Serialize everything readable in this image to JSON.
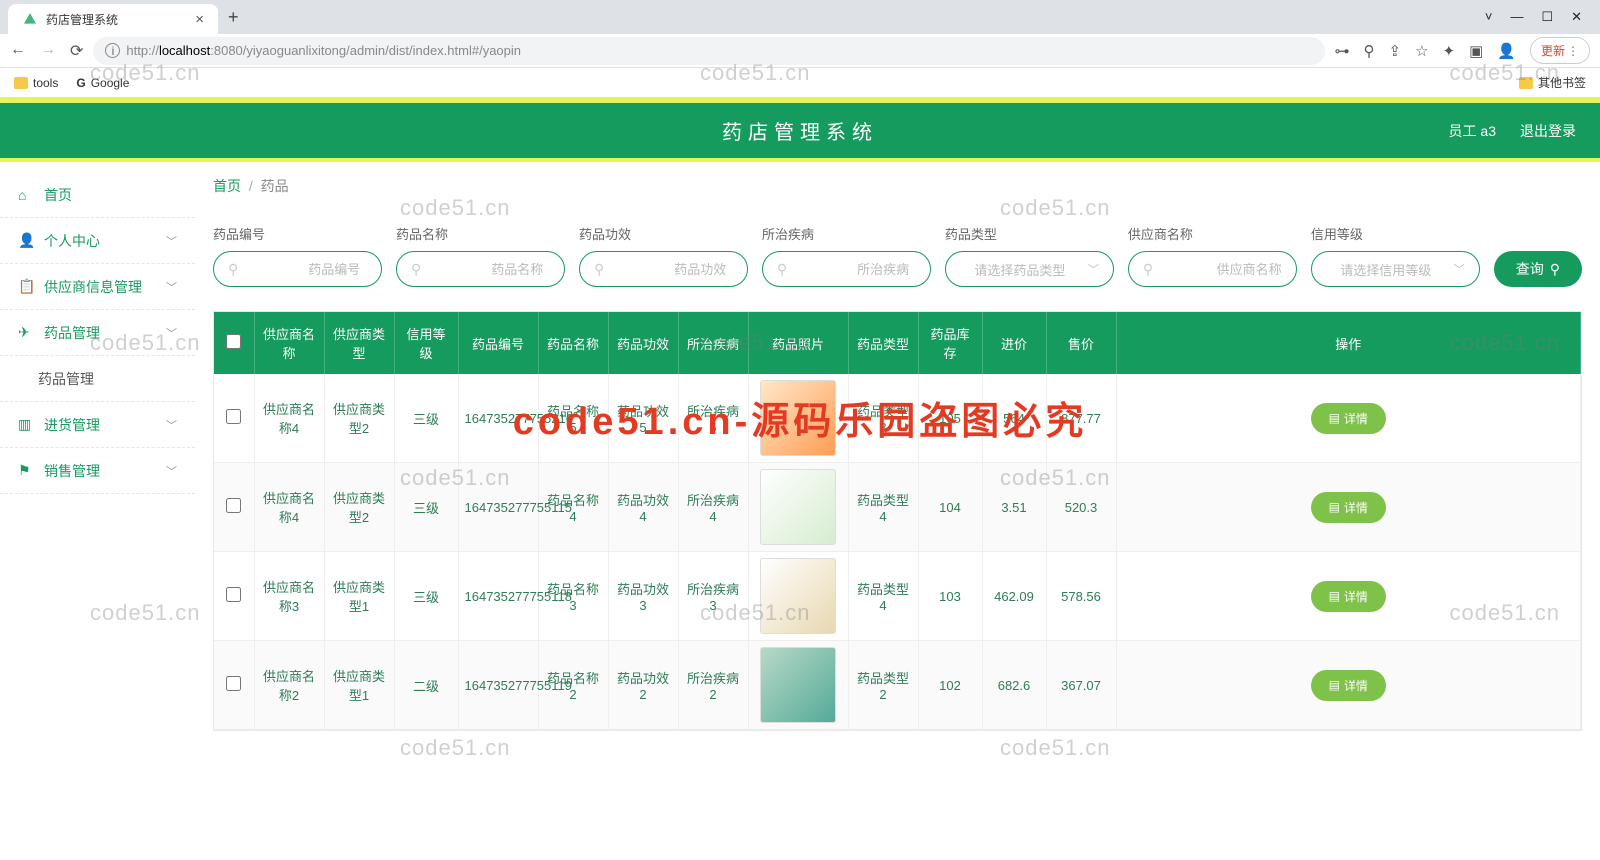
{
  "browser": {
    "tab_title": "药店管理系统",
    "url_scheme_info": "ⓘ",
    "url_prefix": "http://",
    "url_host": "localhost",
    "url_port_path": ":8080/yiyaoguanlixitong/admin/dist/index.html#/yaopin",
    "update_label": "更新",
    "bookmarks": {
      "tools": "tools",
      "google": "Google",
      "other": "其他书签"
    }
  },
  "header": {
    "title": "药店管理系统",
    "user": "员工 a3",
    "logout": "退出登录"
  },
  "sidebar": {
    "home": "首页",
    "personal": "个人中心",
    "supplier": "供应商信息管理",
    "medicine": "药品管理",
    "medicine_sub": "药品管理",
    "inbound": "进货管理",
    "sales": "销售管理"
  },
  "breadcrumb": {
    "home": "首页",
    "current": "药品"
  },
  "filters": {
    "code": {
      "label": "药品编号",
      "placeholder": "药品编号"
    },
    "name": {
      "label": "药品名称",
      "placeholder": "药品名称"
    },
    "func": {
      "label": "药品功效",
      "placeholder": "药品功效"
    },
    "disease": {
      "label": "所治疾病",
      "placeholder": "所治疾病"
    },
    "type": {
      "label": "药品类型",
      "placeholder": "请选择药品类型"
    },
    "supplier": {
      "label": "供应商名称",
      "placeholder": "供应商名称"
    },
    "credit": {
      "label": "信用等级",
      "placeholder": "请选择信用等级"
    },
    "query": "查询"
  },
  "table": {
    "headers": [
      "供应商名称",
      "供应商类型",
      "信用等级",
      "药品编号",
      "药品名称",
      "药品功效",
      "所治疾病",
      "药品照片",
      "药品类型",
      "药品库存",
      "进价",
      "售价",
      "操作"
    ],
    "detail_label": "详情",
    "rows": [
      {
        "supplier": "供应商名称4",
        "stype": "供应商类型2",
        "credit": "三级",
        "code": "164735277755216",
        "name": "药品名称5",
        "func": "药品功效5",
        "disease": "所治疾病5",
        "ptype": "药品类型3",
        "stock": "105",
        "in": "564",
        "out": "877.77",
        "img": "a"
      },
      {
        "supplier": "供应商名称4",
        "stype": "供应商类型2",
        "credit": "三级",
        "code": "164735277755115",
        "name": "药品名称4",
        "func": "药品功效4",
        "disease": "所治疾病4",
        "ptype": "药品类型4",
        "stock": "104",
        "in": "3.51",
        "out": "520.3",
        "img": "b"
      },
      {
        "supplier": "供应商名称3",
        "stype": "供应商类型1",
        "credit": "三级",
        "code": "164735277755118",
        "name": "药品名称3",
        "func": "药品功效3",
        "disease": "所治疾病3",
        "ptype": "药品类型4",
        "stock": "103",
        "in": "462.09",
        "out": "578.56",
        "img": "c"
      },
      {
        "supplier": "供应商名称2",
        "stype": "供应商类型1",
        "credit": "二级",
        "code": "164735277755119",
        "name": "药品名称2",
        "func": "药品功效2",
        "disease": "所治疾病2",
        "ptype": "药品类型2",
        "stock": "102",
        "in": "682.6",
        "out": "367.07",
        "img": "d"
      }
    ]
  },
  "watermarks": {
    "text": "code51.cn",
    "overlay": "code51.cn-源码乐园盗图必究"
  }
}
